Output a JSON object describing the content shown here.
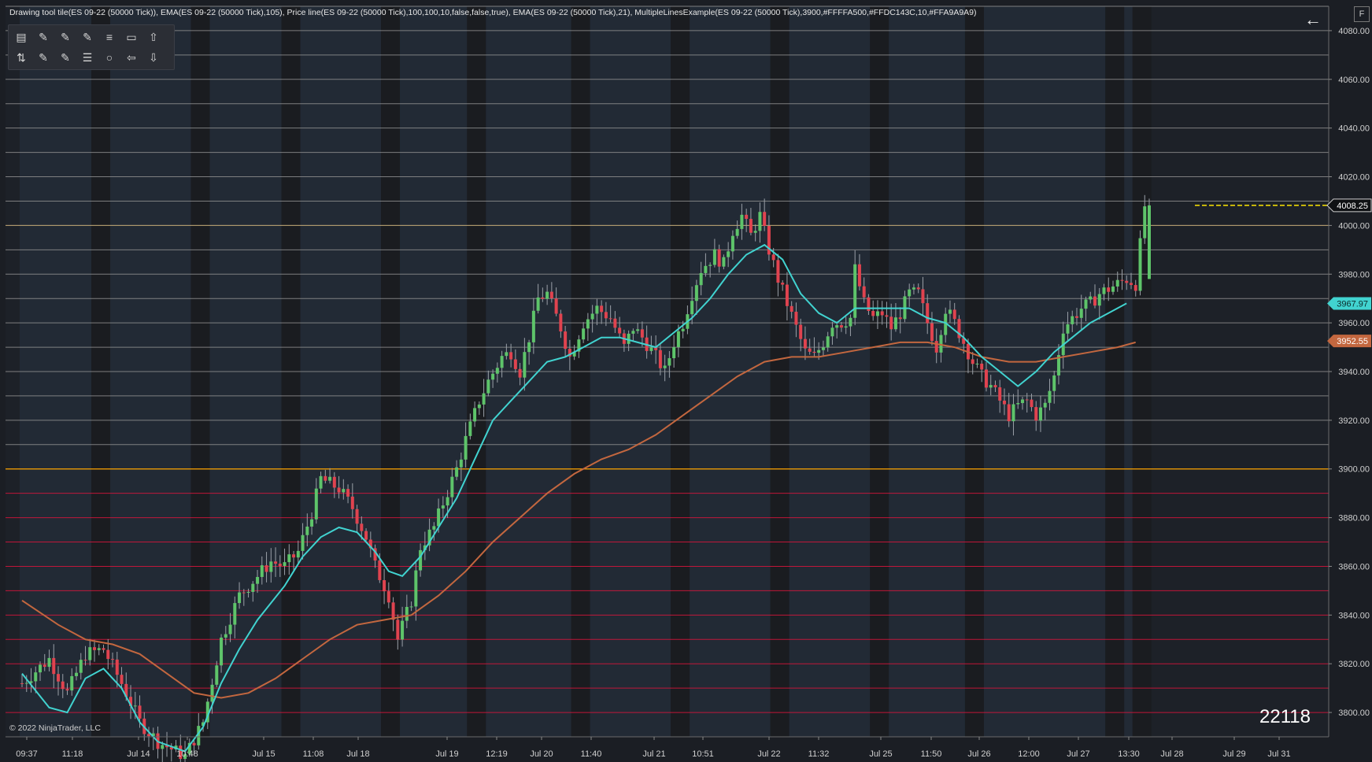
{
  "header": {
    "title": "Drawing tool tile(ES 09-22 (50000 Tick)), EMA(ES 09-22 (50000 Tick),105), Price line(ES 09-22 (50000 Tick),100,100,10,false,false,true), EMA(ES 09-22 (50000 Tick),21), MultipleLinesExample(ES 09-22 (50000 Tick),3900,#FFFFA500,#FFDC143C,10,#FFA9A9A9)",
    "back_icon": "arrow-left-icon",
    "corner_label": "F"
  },
  "toolbar": {
    "row1": [
      "ruler-icon",
      "line-icon",
      "ray-icon",
      "extended-line-icon",
      "fibonacci-icon",
      "rectangle-icon",
      "arrow-up-icon"
    ],
    "row2": [
      "risk-reward-icon",
      "pencil-icon",
      "trend-channel-icon",
      "horizontal-lines-icon",
      "ellipse-icon",
      "arrow-left-outline-icon",
      "arrow-down-icon"
    ]
  },
  "footer": {
    "copyright": "© 2022 NinjaTrader, LLC",
    "bar_count": "22118"
  },
  "colors": {
    "background": "#1b1e24",
    "session_band": "#222a35",
    "session_band_dark": "#1a1c20",
    "up_candle": "#5ec46a",
    "down_candle": "#e0434f",
    "ema_21": "#41d3d0",
    "ema_105": "#c3673f",
    "level_3900": "#FFA500",
    "levels_below": "#DC143C",
    "levels_above": "#A9A9A9",
    "price_line": "#ffe600",
    "last_price_tag": "#0f1114"
  },
  "chart_data": {
    "type": "candlestick",
    "symbol": "ES 09-22 (50000 Tick)",
    "ylim": [
      3790,
      4090
    ],
    "y_ticks": [
      3800,
      3820,
      3840,
      3860,
      3880,
      3900,
      3920,
      3940,
      3960,
      3980,
      4000,
      4020,
      4040,
      4060,
      4080
    ],
    "y_tick_labels": [
      "3800.00",
      "3820.00",
      "3840.00",
      "3860.00",
      "3880.00",
      "3900.00",
      "3920.00",
      "3940.00",
      "3960.00",
      "3980.00",
      "4000.00",
      "4020.00",
      "4040.00",
      "4060.00",
      "4080.00"
    ],
    "x_tick_labels": [
      "09:37",
      "11:18",
      "Jul 14",
      "10:48",
      "Jul 15",
      "11:08",
      "Jul 18",
      "Jul 19",
      "12:19",
      "Jul 20",
      "11:40",
      "Jul 21",
      "10:51",
      "Jul 22",
      "11:32",
      "Jul 25",
      "11:50",
      "Jul 26",
      "12:00",
      "Jul 27",
      "13:30",
      "Jul 28",
      "Jul 29",
      "Jul 31"
    ],
    "session_boundary_labels": [
      "Jul 14",
      "Jul 15",
      "Jul 18",
      "Jul 19",
      "Jul 20",
      "Jul 21",
      "Jul 22",
      "Jul 25",
      "Jul 26",
      "Jul 27"
    ],
    "horizontal_levels": {
      "base": 3900,
      "step": 10,
      "count": 10,
      "above": [
        3910,
        3920,
        3930,
        3940,
        3950,
        3960,
        3970,
        3980,
        3990,
        4000,
        4010,
        4020,
        4030,
        4040,
        4050,
        4060,
        4070,
        4080,
        4090
      ],
      "below": [
        3800,
        3810,
        3820,
        3830,
        3840,
        3850,
        3860,
        3870,
        3880,
        3890
      ]
    },
    "price_line": 4008.25,
    "price_tags": [
      {
        "label": "4008.25",
        "value": 4008.25,
        "series": "last"
      },
      {
        "label": "3967.97",
        "value": 3967.97,
        "series": "EMA 21"
      },
      {
        "label": "3952.55",
        "value": 3952.55,
        "series": "EMA 105"
      }
    ],
    "close_path": [
      [
        0,
        3812
      ],
      [
        6,
        3822
      ],
      [
        10,
        3808
      ],
      [
        14,
        3824
      ],
      [
        18,
        3826
      ],
      [
        22,
        3812
      ],
      [
        26,
        3796
      ],
      [
        30,
        3788
      ],
      [
        36,
        3782
      ],
      [
        40,
        3796
      ],
      [
        44,
        3830
      ],
      [
        48,
        3848
      ],
      [
        52,
        3856
      ],
      [
        55,
        3862
      ],
      [
        58,
        3860
      ],
      [
        61,
        3866
      ],
      [
        64,
        3882
      ],
      [
        66,
        3896
      ],
      [
        70,
        3892
      ],
      [
        73,
        3884
      ],
      [
        76,
        3872
      ],
      [
        78,
        3860
      ],
      [
        81,
        3848
      ],
      [
        83,
        3830
      ],
      [
        86,
        3846
      ],
      [
        88,
        3868
      ],
      [
        91,
        3876
      ],
      [
        93,
        3886
      ],
      [
        96,
        3900
      ],
      [
        98,
        3912
      ],
      [
        101,
        3928
      ],
      [
        103,
        3936
      ],
      [
        106,
        3946
      ],
      [
        108,
        3948
      ],
      [
        110,
        3940
      ],
      [
        112,
        3954
      ],
      [
        114,
        3970
      ],
      [
        116,
        3972
      ],
      [
        119,
        3958
      ],
      [
        121,
        3946
      ],
      [
        124,
        3960
      ],
      [
        127,
        3966
      ],
      [
        130,
        3962
      ],
      [
        133,
        3950
      ],
      [
        135,
        3958
      ],
      [
        137,
        3954
      ],
      [
        140,
        3946
      ],
      [
        142,
        3940
      ],
      [
        144,
        3952
      ],
      [
        146,
        3960
      ],
      [
        148,
        3972
      ],
      [
        150,
        3982
      ],
      [
        153,
        3988
      ],
      [
        155,
        3984
      ],
      [
        157,
        3998
      ],
      [
        159,
        4004
      ],
      [
        161,
        3996
      ],
      [
        163,
        4004
      ],
      [
        165,
        3990
      ],
      [
        167,
        3978
      ],
      [
        169,
        3968
      ],
      [
        171,
        3958
      ],
      [
        173,
        3948
      ],
      [
        175,
        3946
      ],
      [
        177,
        3952
      ],
      [
        179,
        3960
      ],
      [
        181,
        3960
      ],
      [
        183,
        3962
      ],
      [
        184,
        3982
      ],
      [
        186,
        3968
      ],
      [
        188,
        3962
      ],
      [
        190,
        3964
      ],
      [
        192,
        3958
      ],
      [
        194,
        3964
      ],
      [
        196,
        3972
      ],
      [
        198,
        3972
      ],
      [
        200,
        3960
      ],
      [
        202,
        3950
      ],
      [
        204,
        3966
      ],
      [
        206,
        3960
      ],
      [
        208,
        3952
      ],
      [
        210,
        3944
      ],
      [
        212,
        3938
      ],
      [
        214,
        3934
      ],
      [
        216,
        3928
      ],
      [
        218,
        3922
      ],
      [
        220,
        3926
      ],
      [
        222,
        3928
      ],
      [
        224,
        3922
      ],
      [
        226,
        3926
      ],
      [
        228,
        3938
      ],
      [
        230,
        3958
      ],
      [
        232,
        3962
      ],
      [
        234,
        3966
      ],
      [
        236,
        3968
      ],
      [
        238,
        3972
      ],
      [
        240,
        3974
      ],
      [
        242,
        3976
      ],
      [
        244,
        3978
      ],
      [
        246,
        3976
      ],
      [
        248,
        4008
      ]
    ],
    "ema_21": [
      [
        0,
        3816
      ],
      [
        6,
        3802
      ],
      [
        10,
        3800
      ],
      [
        14,
        3814
      ],
      [
        18,
        3818
      ],
      [
        22,
        3810
      ],
      [
        26,
        3796
      ],
      [
        30,
        3788
      ],
      [
        36,
        3784
      ],
      [
        40,
        3794
      ],
      [
        44,
        3812
      ],
      [
        48,
        3826
      ],
      [
        52,
        3838
      ],
      [
        58,
        3852
      ],
      [
        62,
        3864
      ],
      [
        66,
        3872
      ],
      [
        70,
        3876
      ],
      [
        74,
        3874
      ],
      [
        78,
        3866
      ],
      [
        81,
        3858
      ],
      [
        84,
        3856
      ],
      [
        88,
        3864
      ],
      [
        92,
        3876
      ],
      [
        96,
        3888
      ],
      [
        100,
        3904
      ],
      [
        104,
        3920
      ],
      [
        108,
        3928
      ],
      [
        112,
        3936
      ],
      [
        116,
        3944
      ],
      [
        120,
        3946
      ],
      [
        124,
        3950
      ],
      [
        128,
        3954
      ],
      [
        132,
        3954
      ],
      [
        136,
        3952
      ],
      [
        140,
        3950
      ],
      [
        144,
        3956
      ],
      [
        148,
        3962
      ],
      [
        152,
        3970
      ],
      [
        156,
        3980
      ],
      [
        160,
        3988
      ],
      [
        164,
        3992
      ],
      [
        168,
        3986
      ],
      [
        172,
        3972
      ],
      [
        176,
        3964
      ],
      [
        180,
        3960
      ],
      [
        184,
        3966
      ],
      [
        188,
        3966
      ],
      [
        192,
        3966
      ],
      [
        196,
        3966
      ],
      [
        200,
        3962
      ],
      [
        204,
        3960
      ],
      [
        208,
        3954
      ],
      [
        212,
        3946
      ],
      [
        216,
        3940
      ],
      [
        220,
        3934
      ],
      [
        224,
        3940
      ],
      [
        228,
        3948
      ],
      [
        232,
        3954
      ],
      [
        236,
        3960
      ],
      [
        240,
        3964
      ],
      [
        244,
        3968
      ]
    ],
    "ema_105": [
      [
        0,
        3846
      ],
      [
        8,
        3836
      ],
      [
        14,
        3830
      ],
      [
        20,
        3828
      ],
      [
        26,
        3824
      ],
      [
        32,
        3816
      ],
      [
        38,
        3808
      ],
      [
        44,
        3806
      ],
      [
        50,
        3808
      ],
      [
        56,
        3814
      ],
      [
        62,
        3822
      ],
      [
        68,
        3830
      ],
      [
        74,
        3836
      ],
      [
        80,
        3838
      ],
      [
        86,
        3840
      ],
      [
        92,
        3848
      ],
      [
        98,
        3858
      ],
      [
        104,
        3870
      ],
      [
        110,
        3880
      ],
      [
        116,
        3890
      ],
      [
        122,
        3898
      ],
      [
        128,
        3904
      ],
      [
        134,
        3908
      ],
      [
        140,
        3914
      ],
      [
        146,
        3922
      ],
      [
        152,
        3930
      ],
      [
        158,
        3938
      ],
      [
        164,
        3944
      ],
      [
        170,
        3946
      ],
      [
        176,
        3946
      ],
      [
        182,
        3948
      ],
      [
        188,
        3950
      ],
      [
        194,
        3952
      ],
      [
        200,
        3952
      ],
      [
        206,
        3950
      ],
      [
        212,
        3946
      ],
      [
        218,
        3944
      ],
      [
        224,
        3944
      ],
      [
        230,
        3946
      ],
      [
        236,
        3948
      ],
      [
        242,
        3950
      ],
      [
        246,
        3952
      ]
    ]
  }
}
